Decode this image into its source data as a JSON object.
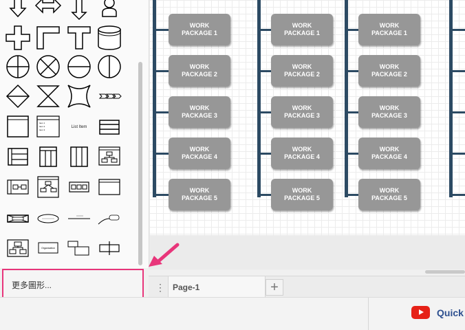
{
  "sidebar": {
    "more_shapes_label": "更多圖形...",
    "shapes": [
      {
        "name": "arrow-down-shape-icon",
        "row": 0,
        "col": 0
      },
      {
        "name": "arrow-left-right-shape-icon",
        "row": 0,
        "col": 1
      },
      {
        "name": "arrow-up-down-shape-icon",
        "row": 0,
        "col": 2
      },
      {
        "name": "user-shape-icon",
        "row": 0,
        "col": 3
      },
      {
        "name": "cross-shape-icon",
        "row": 1,
        "col": 0
      },
      {
        "name": "corner-shape-icon",
        "row": 1,
        "col": 1
      },
      {
        "name": "tee-shape-icon",
        "row": 1,
        "col": 2
      },
      {
        "name": "cylinder-shape-icon",
        "row": 1,
        "col": 3
      },
      {
        "name": "or-circle-shape-icon",
        "row": 2,
        "col": 0
      },
      {
        "name": "x-circle-shape-icon",
        "row": 2,
        "col": 1
      },
      {
        "name": "minus-circle-shape-icon",
        "row": 2,
        "col": 2
      },
      {
        "name": "half-circle-shape-icon",
        "row": 2,
        "col": 3
      },
      {
        "name": "diamond-shape-icon",
        "row": 3,
        "col": 0
      },
      {
        "name": "hourglass-shape-icon",
        "row": 3,
        "col": 1
      },
      {
        "name": "star4-shape-icon",
        "row": 3,
        "col": 2
      },
      {
        "name": "chevron-chain-shape-icon",
        "row": 3,
        "col": 3
      },
      {
        "name": "window-shape-icon",
        "row": 4,
        "col": 0
      },
      {
        "name": "list-shape-icon",
        "row": 4,
        "col": 1
      },
      {
        "name": "list-item-shape-icon",
        "row": 4,
        "col": 2
      },
      {
        "name": "table-rows-shape-icon",
        "row": 4,
        "col": 3
      },
      {
        "name": "horizontal-pool-shape-icon",
        "row": 5,
        "col": 0
      },
      {
        "name": "vertical-pool-shape-icon",
        "row": 5,
        "col": 1
      },
      {
        "name": "vertical-lanes-shape-icon",
        "row": 5,
        "col": 2
      },
      {
        "name": "org-tree-shape-icon",
        "row": 5,
        "col": 3
      },
      {
        "name": "container-link-shape-icon",
        "row": 6,
        "col": 0
      },
      {
        "name": "flow-tree-shape-icon",
        "row": 6,
        "col": 1
      },
      {
        "name": "chain-boxes-shape-icon",
        "row": 6,
        "col": 2
      },
      {
        "name": "titled-box-shape-icon",
        "row": 6,
        "col": 3
      },
      {
        "name": "crossed-box-shape-icon",
        "row": 7,
        "col": 0
      },
      {
        "name": "ellipse-label-shape-icon",
        "row": 7,
        "col": 1
      },
      {
        "name": "line-label-shape-icon",
        "row": 7,
        "col": 2
      },
      {
        "name": "curve-label-shape-icon",
        "row": 7,
        "col": 3
      },
      {
        "name": "org-chart-shape-icon",
        "row": 8,
        "col": 0
      },
      {
        "name": "organization-box-shape-icon",
        "row": 8,
        "col": 1
      },
      {
        "name": "step-boxes-shape-icon",
        "row": 8,
        "col": 2
      },
      {
        "name": "split-box-shape-icon",
        "row": 8,
        "col": 3
      }
    ],
    "shape_labels": {
      "list_item": "List Item",
      "organization": "Organization",
      "tiny_1": "Item 1",
      "tiny_2": "Item 2",
      "tiny_3": "Item 3"
    }
  },
  "canvas": {
    "columns": [
      {
        "id": "col-1",
        "packages": [
          "WORK|PACKAGE 1",
          "WORK|PACKAGE 2",
          "WORK|PACKAGE 3",
          "WORK|PACKAGE 4",
          "WORK|PACKAGE 5"
        ]
      },
      {
        "id": "col-2",
        "packages": [
          "WORK|PACKAGE 1",
          "WORK|PACKAGE 2",
          "WORK|PACKAGE 3",
          "WORK|PACKAGE 4",
          "WORK|PACKAGE 5"
        ]
      },
      {
        "id": "col-3",
        "packages": [
          "WORK|PACKAGE 1",
          "WORK|PACKAGE 2",
          "WORK|PACKAGE 3",
          "WORK|PACKAGE 4",
          "WORK|PACKAGE 5"
        ]
      }
    ],
    "connector_color": "#2c4a63",
    "package_color": "#979797"
  },
  "tabs": {
    "menu_icon": "⋮",
    "pages": [
      {
        "label": "Page-1"
      }
    ],
    "add_label": "+"
  },
  "footer": {
    "quick_label": "Quick"
  },
  "colors": {
    "highlight": "#e8357a",
    "youtube": "#e62117"
  }
}
